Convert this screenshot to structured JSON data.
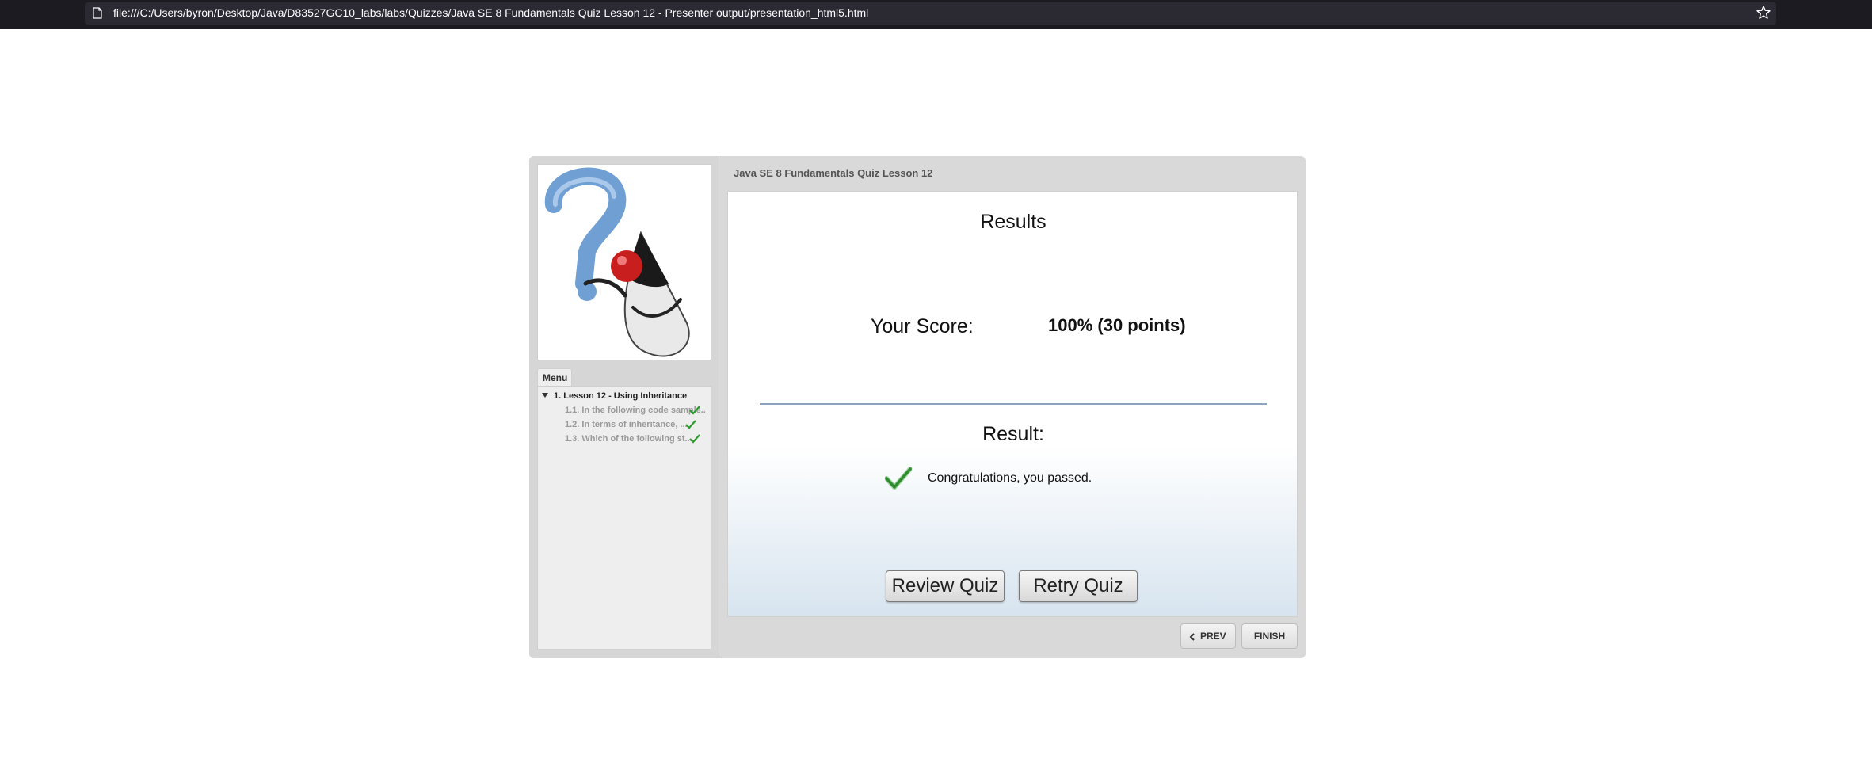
{
  "browser": {
    "url": "file:///C:/Users/byron/Desktop/Java/D83527GC10_labs/labs/Quizzes/Java SE 8 Fundamentals Quiz Lesson 12 - Presenter output/presentation_html5.html",
    "page_icon": "page-icon",
    "bookmark_icon": "star-icon"
  },
  "player": {
    "title": "Java SE 8 Fundamentals Quiz Lesson 12",
    "menu": {
      "tab_label": "Menu",
      "lesson": "1. Lesson 12 - Using Inheritance",
      "items": [
        {
          "label": "1.1. In the following code sample...",
          "completed": true
        },
        {
          "label": "1.2. In terms of inheritance, ...",
          "completed": true
        },
        {
          "label": "1.3. Which of the following st...",
          "completed": true
        }
      ]
    },
    "results": {
      "heading": "Results",
      "score_label": "Your Score:",
      "score_value": "100% (30 points)",
      "result_label": "Result:",
      "result_text": "Congratulations, you passed.",
      "passed": true
    },
    "buttons": {
      "review": "Review Quiz",
      "retry": "Retry Quiz",
      "prev": "PREV",
      "finish": "FINISH"
    },
    "colors": {
      "accent_check": "#2e8b2e",
      "frame": "#d9d9d9"
    }
  }
}
